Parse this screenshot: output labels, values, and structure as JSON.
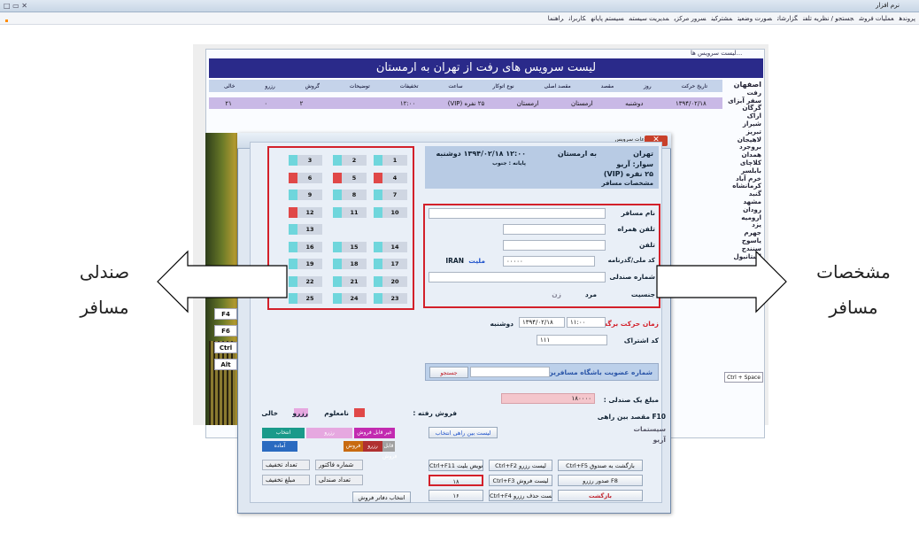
{
  "window": {
    "title": "نرم افزار",
    "controls": "□ ▭ ✕"
  },
  "menu": [
    "پرونده",
    "عملیات فروش",
    "جستجو / نظریه تلفن",
    "گزارشات",
    "صورت وضعیت",
    "مشترکین",
    "سرور مرکزی",
    "مدیریت سیستم",
    "سیستم پایانه",
    "کاربران",
    "راهنما"
  ],
  "list_window": {
    "title": "لیست سرویس ها...",
    "header_bar": "لیست سرویس های رفت از تهران به ارمستان",
    "columns": [
      "تاریخ حرکت",
      "روز",
      "مقصد",
      "مقصد اصلی",
      "نوع اتوکار",
      "ساعت",
      "تخفیفات",
      "توضیحات",
      "گروش",
      "رزرو",
      "خالی"
    ],
    "row": [
      "۱۳۹۴/۰۲/۱۸",
      "دوشنبه",
      "ارمستان",
      "ارمستان",
      "۲۵ نفره (VIP)",
      "۱۲:۰۰",
      "",
      "",
      "۲",
      "۰",
      "۲۱"
    ],
    "cities_header": "اصفهان",
    "cities": [
      "رفت",
      "سفر آبزای",
      "گرگان",
      "اراک",
      "شیراز",
      "تبریز",
      "لاهیجان",
      "بروجرد",
      "همدان",
      "کلاچای",
      "بابلسر",
      "خرم آباد",
      "کرمانشاه",
      "گنبد",
      "مشهد",
      "رودان",
      "ارومیه",
      "یزد",
      "جهرم",
      "یاسوج",
      "سنندج",
      "استانبول"
    ],
    "shortcut": "Ctrl + Space"
  },
  "side_keys": [
    "F4",
    "F6",
    "Ctrl",
    "Alt"
  ],
  "dialog": {
    "title": "اطلاعات سرویس",
    "close": "✕",
    "info": {
      "line1": "تهران",
      "to": "به ارمستان",
      "date_time": "۱۲:۰۰ ۱۳۹۴/۰۲/۱۸ دوشنبه",
      "bus": "سوار: آریو",
      "type": "۲۵ نفره (VIP)",
      "passenger_details": "مشخصات مسافر",
      "gate": "پایانه : جنوب"
    },
    "form": {
      "name_label": "نام مسافر",
      "companion_label": "تلفن همراه",
      "phone_label": "تلفن",
      "national_label": "کد ملی/گذرنامه",
      "national_value": "۰۰۰۰۰",
      "nationality_label": "ملیت",
      "nationality_value": "IRAN",
      "seat_no_label": "شماره صندلی",
      "gender_label": "جنسیت",
      "male": "مرد",
      "female": "زن"
    },
    "return_label": "زمان حرکت برگشت",
    "return_time": "۱۱:۰۰",
    "return_date": "۱۳۹۴/۰۲/۱۸",
    "return_day": "دوشنبه",
    "subscription_label": "کد اشتراک",
    "subscription_value": "۱۱۱",
    "membership": "شماره عضویت باشگاه مسافرین :",
    "membership_btn": "جستجو",
    "price_label": "مبلغ یک صندلی :",
    "price_value": "۱۸۰۰۰۰",
    "f10": "F10",
    "intercity": "مقصد بین راهی",
    "intercity_list": "لیست بین راهی انتخاب",
    "option_a": "سیستمات",
    "option_b": "آریو",
    "legend": {
      "sold_label": "فروش رفته :",
      "unavailable": "نامعلوم",
      "reserve": "رزرو",
      "empty": "خالی",
      "gray_label": "نامعلوم",
      "items": [
        "غیر قابل فروش",
        "رزرو",
        "انتخاب",
        "قابل فروش",
        "رزرو",
        "فروش",
        "آماده"
      ]
    },
    "fields": {
      "f1": "شماره فاکتور",
      "f2": "تعداد صندلی",
      "f3": "مبلغ تخفیف",
      "f4": "تعداد تخفیف"
    },
    "buttons": {
      "b1": "Ctrl+F1 لیست رزرو",
      "b2": "Ctrl+F2 لیست رزرو",
      "b3": "Ctrl+F3 لیست فروش",
      "b4": "Ctrl+F4 لیست حذف رزرو",
      "b5": "Ctrl+F11 تعویض بلیت",
      "b6": "Ctrl+F5 بازگشت به صندوق",
      "b7": "صدور رزرو F8",
      "b8": "بازگشت",
      "b9": "انتخاب دفاتر فروش",
      "b10": "۱۸",
      "b11": "۱۶",
      "b12": "۱۵"
    }
  },
  "seats": [
    {
      "n": "3",
      "r": false
    },
    {
      "n": "2",
      "r": false
    },
    {
      "n": "1",
      "r": false
    },
    {
      "n": "6",
      "r": true
    },
    {
      "n": "5",
      "r": true
    },
    {
      "n": "4",
      "r": true
    },
    {
      "n": "9",
      "r": false
    },
    {
      "n": "8",
      "r": false
    },
    {
      "n": "7",
      "r": false
    },
    {
      "n": "12",
      "r": true
    },
    {
      "n": "11",
      "r": false
    },
    {
      "n": "10",
      "r": false
    },
    {
      "n": "13",
      "r": false
    },
    {
      "n": "16",
      "r": false
    },
    {
      "n": "15",
      "r": false
    },
    {
      "n": "14",
      "r": false
    },
    {
      "n": "19",
      "r": false
    },
    {
      "n": "18",
      "r": false
    },
    {
      "n": "17",
      "r": false
    },
    {
      "n": "22",
      "r": false
    },
    {
      "n": "21",
      "r": false
    },
    {
      "n": "20",
      "r": false
    },
    {
      "n": "25",
      "r": false
    },
    {
      "n": "24",
      "r": false
    },
    {
      "n": "23",
      "r": false
    }
  ],
  "annotations": {
    "left_line1": "صندلی",
    "left_line2": "مسافر",
    "right_line1": "مشخصات",
    "right_line2": "مسافر"
  }
}
